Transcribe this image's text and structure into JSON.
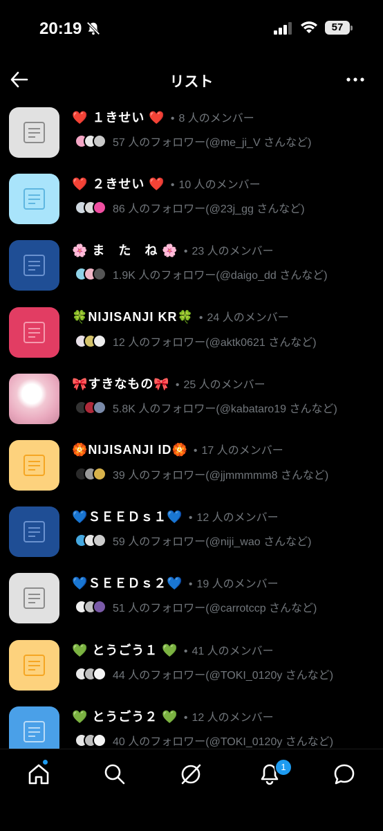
{
  "status": {
    "time": "20:19",
    "battery": "57"
  },
  "header": {
    "title": "リスト"
  },
  "lists": [
    {
      "name": "❤️ １きせい ❤️",
      "members": "8 人のメンバー",
      "followers": "57 人のフォロワー(@me_ji_V さんなど)",
      "thumb_color": "#e1e1e1",
      "icon_color": "#8c8c8c",
      "avatars": [
        "#f4a6c5",
        "#e7e7e7",
        "#c9c9c9"
      ]
    },
    {
      "name": "❤️ ２きせい ❤️",
      "members": "10 人のメンバー",
      "followers": "86 人のフォロワー(@23j_gg さんなど)",
      "thumb_color": "#a9e4fb",
      "icon_color": "#5fb6e0",
      "avatars": [
        "#cfd8e0",
        "#d9d9d9",
        "#f04fa1"
      ]
    },
    {
      "name": "🌸 ま　た　ね 🌸",
      "members": "23 人のメンバー",
      "followers": "1.9K 人のフォロワー(@daigo_dd さんなど)",
      "thumb_color": "#1f4e95",
      "icon_color": "#6b92cf",
      "avatars": [
        "#8fd3e8",
        "#f1b7c7",
        "#555555"
      ]
    },
    {
      "name": "🍀NIJISANJI KR🍀",
      "members": "24 人のメンバー",
      "followers": "12 人のフォロワー(@aktk0621 さんなど)",
      "thumb_color": "#e23d63",
      "icon_color": "#f59aae",
      "avatars": [
        "#e8e0e8",
        "#d4c36b",
        "#eeeeee"
      ]
    },
    {
      "name": "🎀すきなもの🎀",
      "members": "25 人のメンバー",
      "followers": "5.8K 人のフォロワー(@kabataro19 さんなど)",
      "thumb_color": "#f2c7d3",
      "icon_color": "",
      "photo": true,
      "avatars": [
        "#333333",
        "#b02a3a",
        "#7a8aa8"
      ]
    },
    {
      "name": "🏵️NIJISANJI ID🏵️",
      "members": "17 人のメンバー",
      "followers": "39 人のフォロワー(@jjmmmmm8 さんなど)",
      "thumb_color": "#fdd27d",
      "icon_color": "#f5a623",
      "avatars": [
        "#2a2a2a",
        "#9a9a9a",
        "#d8b24a"
      ]
    },
    {
      "name": "💙ＳＥＥＤｓ１💙",
      "members": "12 人のメンバー",
      "followers": "59 人のフォロワー(@niji_wao さんなど)",
      "thumb_color": "#1f4e95",
      "icon_color": "#6b92cf",
      "avatars": [
        "#45a8e0",
        "#e5e5e5",
        "#cccccc"
      ]
    },
    {
      "name": "💙ＳＥＥＤｓ２💙",
      "members": "19 人のメンバー",
      "followers": "51 人のフォロワー(@carrotccp さんなど)",
      "thumb_color": "#e1e1e1",
      "icon_color": "#8c8c8c",
      "avatars": [
        "#f0f0f0",
        "#c0c0c0",
        "#7a5aa8"
      ]
    },
    {
      "name": "💚 とうごう１ 💚",
      "members": "41 人のメンバー",
      "followers": "44 人のフォロワー(@TOKI_0120y さんなど)",
      "thumb_color": "#fdd27d",
      "icon_color": "#f5a623",
      "avatars": [
        "#e8e8e8",
        "#bfbfbf",
        "#f4f4f4"
      ]
    },
    {
      "name": "💚 とうごう２ 💚",
      "members": "12 人のメンバー",
      "followers": "40 人のフォロワー(@TOKI_0120y さんなど)",
      "thumb_color": "#4aa0e8",
      "icon_color": "#b9dbf7",
      "avatars": [
        "#e8e8e8",
        "#bfbfbf",
        "#f4f4f4"
      ]
    }
  ],
  "bottom_nav": {
    "notifications_badge": "1"
  }
}
